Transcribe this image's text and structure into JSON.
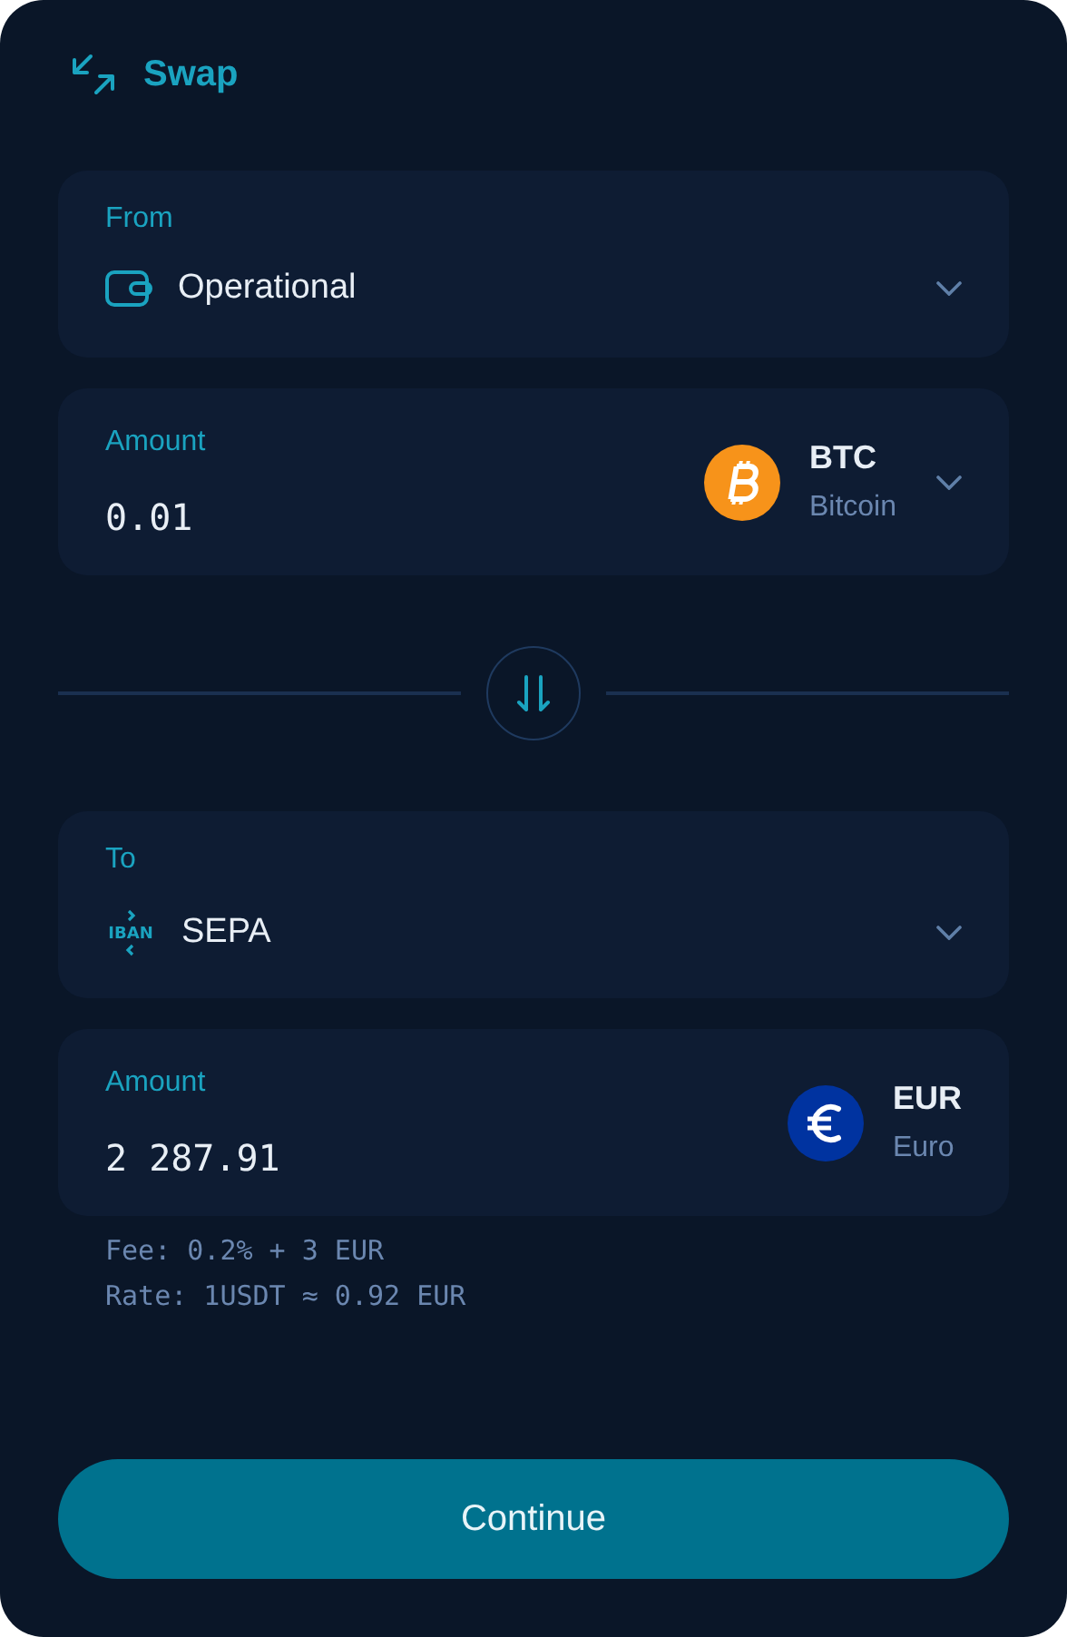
{
  "header": {
    "title": "Swap"
  },
  "from": {
    "label": "From",
    "kind": "wallet",
    "value": "Operational"
  },
  "from_amount": {
    "label": "Amount",
    "value": "0.01",
    "currency": {
      "code": "BTC",
      "name": "Bitcoin",
      "kind": "btc",
      "color": "#f7931a"
    },
    "dropdown": true
  },
  "to": {
    "label": "To",
    "kind": "iban",
    "icon_text": "IBAN",
    "value": "SEPA"
  },
  "to_amount": {
    "label": "Amount",
    "value": "2 287.91",
    "currency": {
      "code": "EUR",
      "name": "Euro",
      "kind": "eur",
      "color": "#0033a0"
    },
    "dropdown": false
  },
  "notes": [
    "Fee: 0.2% + 3 EUR",
    "Rate: 1USDT ≈ 0.92 EUR"
  ],
  "button": {
    "label": "Continue"
  }
}
